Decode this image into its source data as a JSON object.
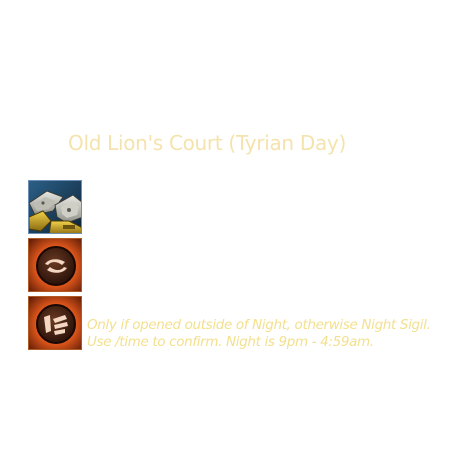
{
  "tooltip": {
    "title": "Old Lion's Court (Tyrian Day)",
    "note": {
      "line1": "Only if opened outside of Night, otherwise Night Sigil.",
      "line2": "Use /time to confirm. Night is 9pm - 4:59am."
    }
  },
  "icons": [
    {
      "name": "armor-pieces-icon"
    },
    {
      "name": "swirl-sigil-icon"
    },
    {
      "name": "claw-sigil-icon"
    }
  ],
  "colors": {
    "title": "#f5e3ad",
    "note": "#f3e08e",
    "sigil_glow": "#e0621a"
  }
}
